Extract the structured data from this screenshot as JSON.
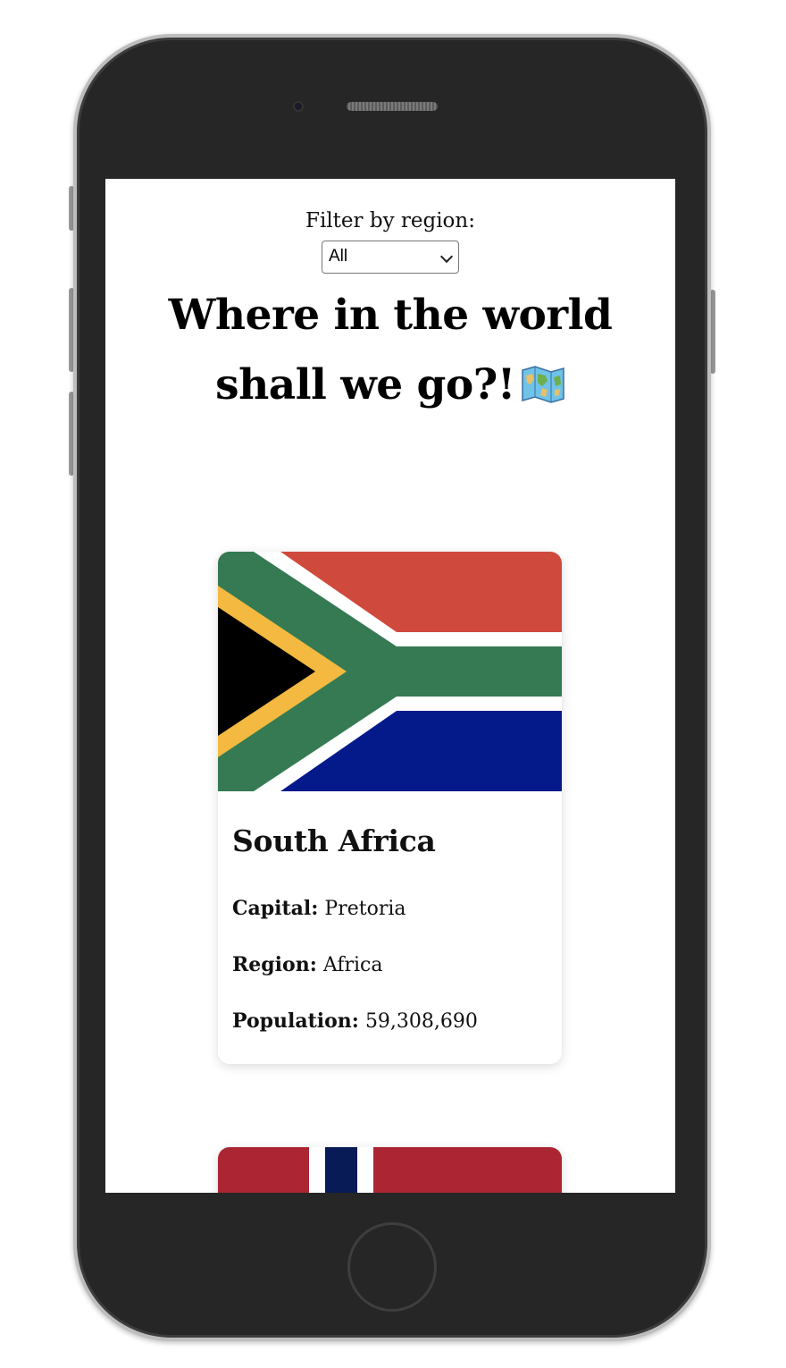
{
  "filter": {
    "label": "Filter by region:",
    "selected": "All"
  },
  "heading": {
    "text": "Where in the world shall we go?!",
    "icon": "world-map-icon"
  },
  "countries": [
    {
      "name": "South Africa",
      "flag": "south-africa-flag",
      "capital_label": "Capital:",
      "capital": "Pretoria",
      "region_label": "Region:",
      "region": "Africa",
      "population_label": "Population:",
      "population": "59,308,690"
    },
    {
      "flag": "norway-flag"
    }
  ],
  "colors": {
    "za_red": "#cf4a3c",
    "za_green": "#357a52",
    "za_blue": "#041a8b",
    "za_gold": "#f3b940",
    "no_red": "#ab2632",
    "no_blue": "#081b57"
  }
}
